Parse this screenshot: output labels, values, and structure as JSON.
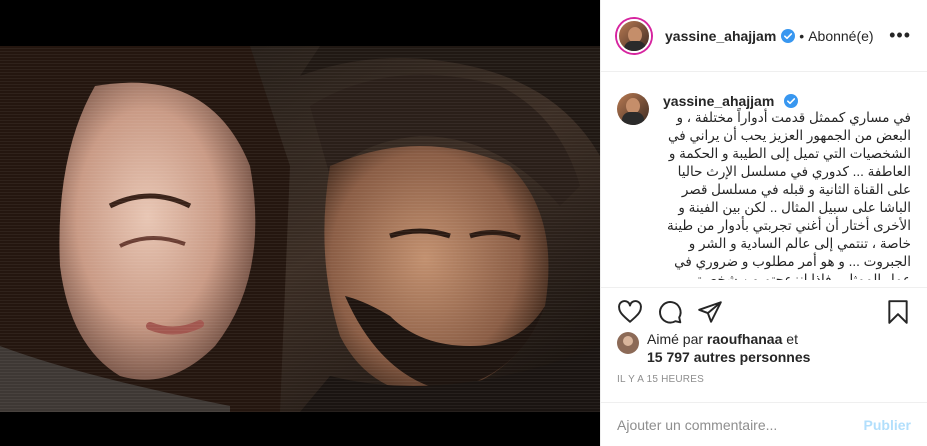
{
  "post": {
    "username": "yassine_ahajjam",
    "follow_status": "Abonné(e)",
    "separator": "•",
    "more": "•••"
  },
  "caption": {
    "username": "yassine_ahajjam",
    "text": "في مساري كممثل قدمت أدواراً مختلفة ، و البعض من الجمهور العزيز يحب أن يراني في الشخصيات التي تميل إلى الطيبة و الحكمة و العاطفة ... كدوري في مسلسل الإرث حاليا على القناة الثانية و قبله في مسلسل قصر الباشا على سبيل المثال .. لكن بين الفينة و الأخرى أختار أن أغني تجربتي بأدوار من طينة خاصة ، تنتمي إلى عالم السادية و الشر و الجبروت ... و هو أمر مطلوب و ضروري في عمل الممثل ، فإذا انزعجتم من شخصيتي الابليسية ذات التركيبة النفسية المعقدة في"
  },
  "likes": {
    "prefix": "Aimé par",
    "liker": "raoufhanaa",
    "conj": "et",
    "others": "15 797 autres personnes"
  },
  "timestamp": "Il y a 15 heures",
  "comment": {
    "placeholder": "Ajouter un commentaire...",
    "submit": "Publier"
  },
  "colors": {
    "verified": "#3897f0",
    "publish_disabled": "#b2dffc",
    "story_ring": "#d6249f"
  },
  "icons": [
    "heart-icon",
    "comment-icon",
    "share-icon",
    "bookmark-icon",
    "verified-badge-icon"
  ]
}
